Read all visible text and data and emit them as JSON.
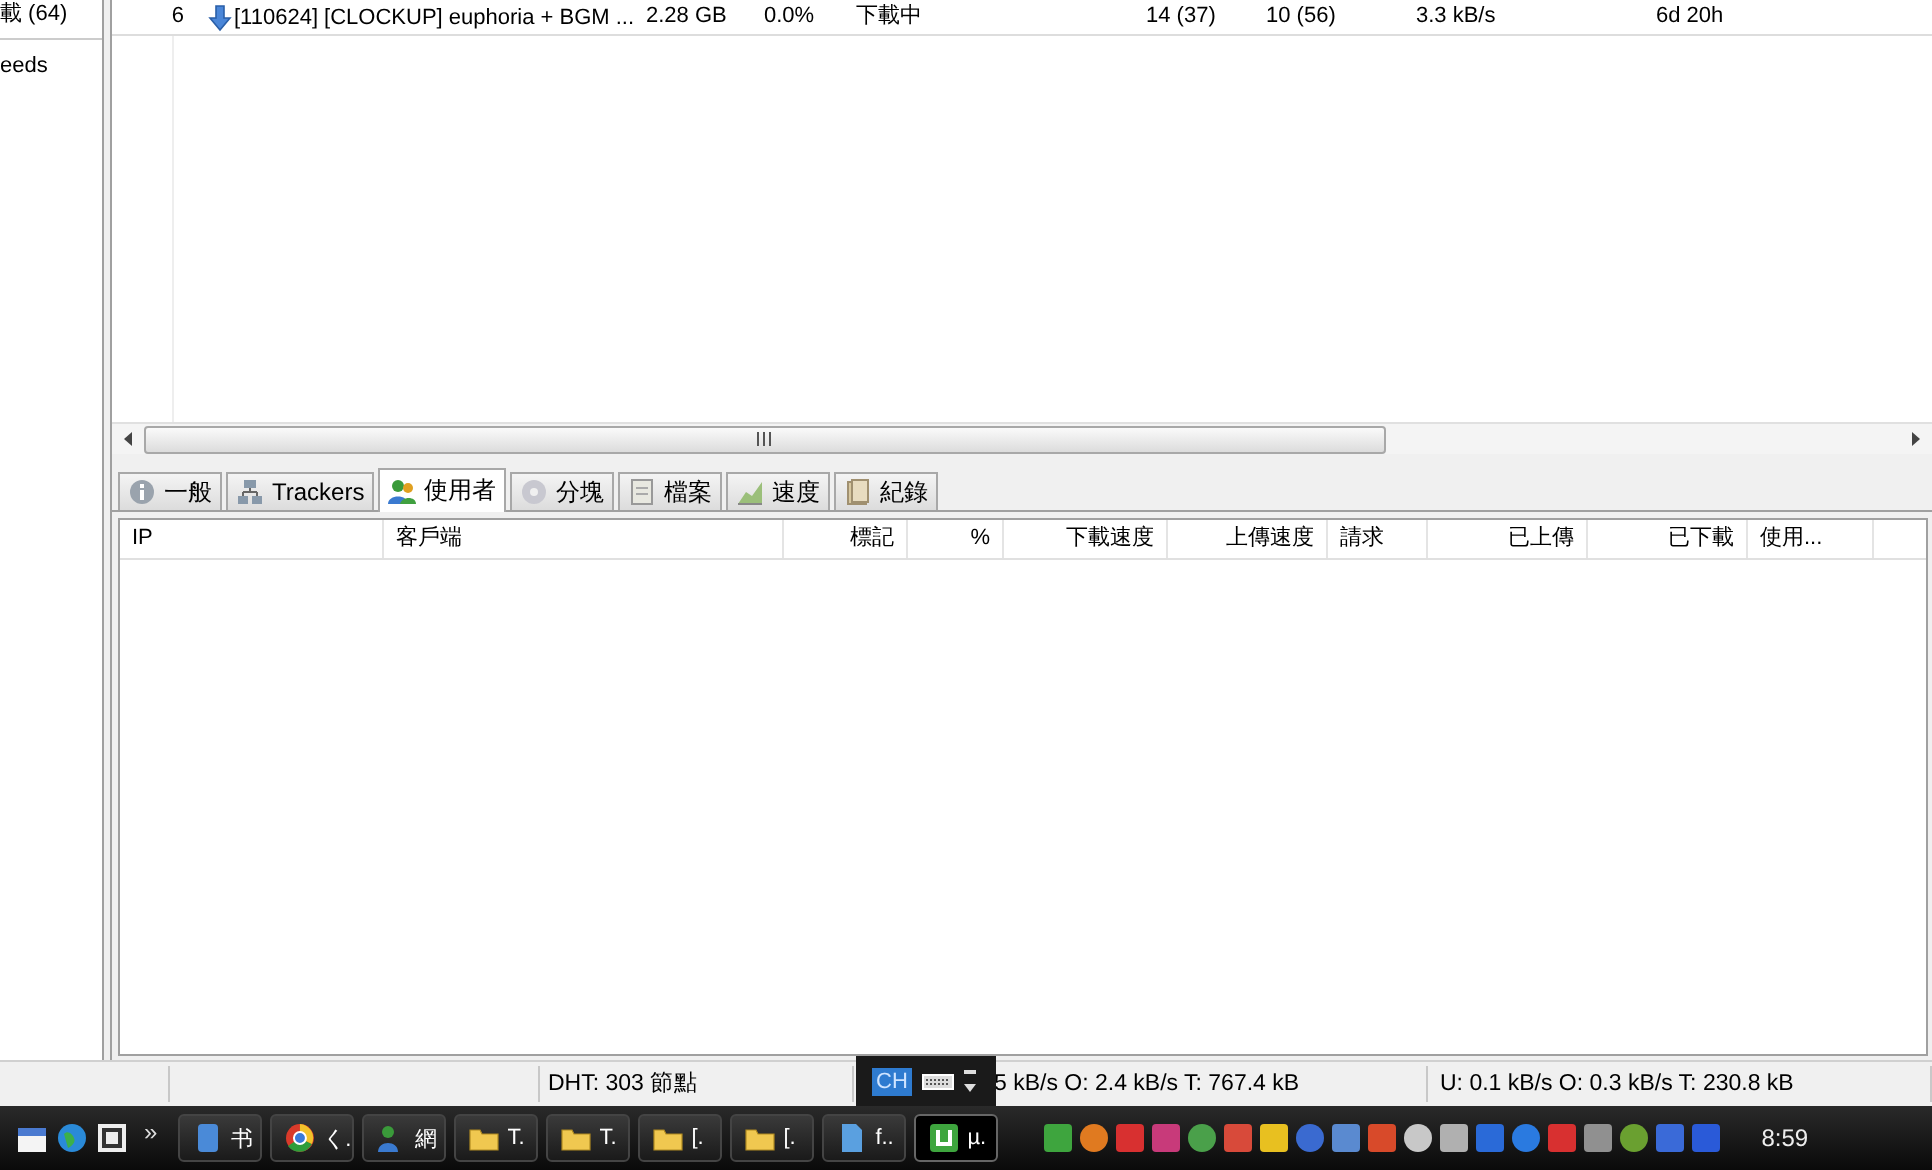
{
  "sidebar": {
    "items": [
      {
        "label": "載 (64)"
      },
      {
        "label": "eeds"
      }
    ]
  },
  "torrents": [
    {
      "number": "6",
      "name": "[110624] [CLOCKUP] euphoria + BGM ...",
      "size": "2.28 GB",
      "done": "0.0%",
      "status": "下載中",
      "seeds": "14 (37)",
      "peers": "10 (56)",
      "down_speed": "3.3 kB/s",
      "eta": "6d 20h",
      "selected": false
    }
  ],
  "tabs": [
    {
      "label": "一般",
      "selected": false
    },
    {
      "label": "Trackers",
      "selected": false
    },
    {
      "label": "使用者",
      "selected": true
    },
    {
      "label": "分塊",
      "selected": false
    },
    {
      "label": "檔案",
      "selected": false
    },
    {
      "label": "速度",
      "selected": false
    },
    {
      "label": "紀錄",
      "selected": false
    }
  ],
  "peers_table": {
    "columns": [
      {
        "label": "IP"
      },
      {
        "label": "客戶端"
      },
      {
        "label": "標記"
      },
      {
        "label": "%"
      },
      {
        "label": "下載速度"
      },
      {
        "label": "上傳速度"
      },
      {
        "label": "請求"
      },
      {
        "label": "已上傳"
      },
      {
        "label": "已下載"
      },
      {
        "label": "使用..."
      }
    ]
  },
  "status_bar": {
    "dht": "DHT: 303 節點",
    "download": "5 kB/s O: 2.4 kB/s T: 767.4 kB",
    "upload": "U: 0.1 kB/s O: 0.3 kB/s T: 230.8 kB"
  },
  "language_bar": {
    "language": "CH"
  },
  "taskbar": {
    "overflow": "»",
    "buttons": [
      {
        "label": "书",
        "selected": false
      },
      {
        "label": "く.",
        "selected": false
      },
      {
        "label": "網",
        "selected": false
      },
      {
        "label": "T.",
        "selected": false
      },
      {
        "label": "T.",
        "selected": false
      },
      {
        "label": "[.",
        "selected": false
      },
      {
        "label": "[.",
        "selected": false
      },
      {
        "label": "f..",
        "selected": false
      },
      {
        "label": "µ.",
        "selected": true
      }
    ],
    "clock": "8:59"
  }
}
